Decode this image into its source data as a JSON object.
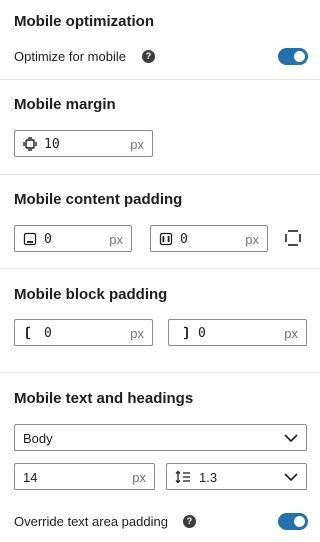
{
  "optimization": {
    "title": "Mobile optimization",
    "label": "Optimize for mobile",
    "help": "?",
    "enabled": true
  },
  "margin": {
    "title": "Mobile margin",
    "value": "10",
    "unit": "px"
  },
  "content_padding": {
    "title": "Mobile content padding",
    "vertical": {
      "value": "0",
      "unit": "px"
    },
    "horizontal": {
      "value": "0",
      "unit": "px"
    }
  },
  "block_padding": {
    "title": "Mobile block padding",
    "left": {
      "value": "0",
      "unit": "px"
    },
    "right": {
      "value": "0",
      "unit": "px"
    }
  },
  "text": {
    "title": "Mobile text and headings",
    "style_select": "Body",
    "font_size": {
      "value": "14",
      "unit": "px"
    },
    "line_height": "1.3",
    "override_label": "Override text area padding",
    "override_help": "?",
    "override_enabled": true
  },
  "colors": {
    "accent": "#2271b1",
    "border": "#8c8c8c",
    "divider": "#e5e5e5"
  }
}
